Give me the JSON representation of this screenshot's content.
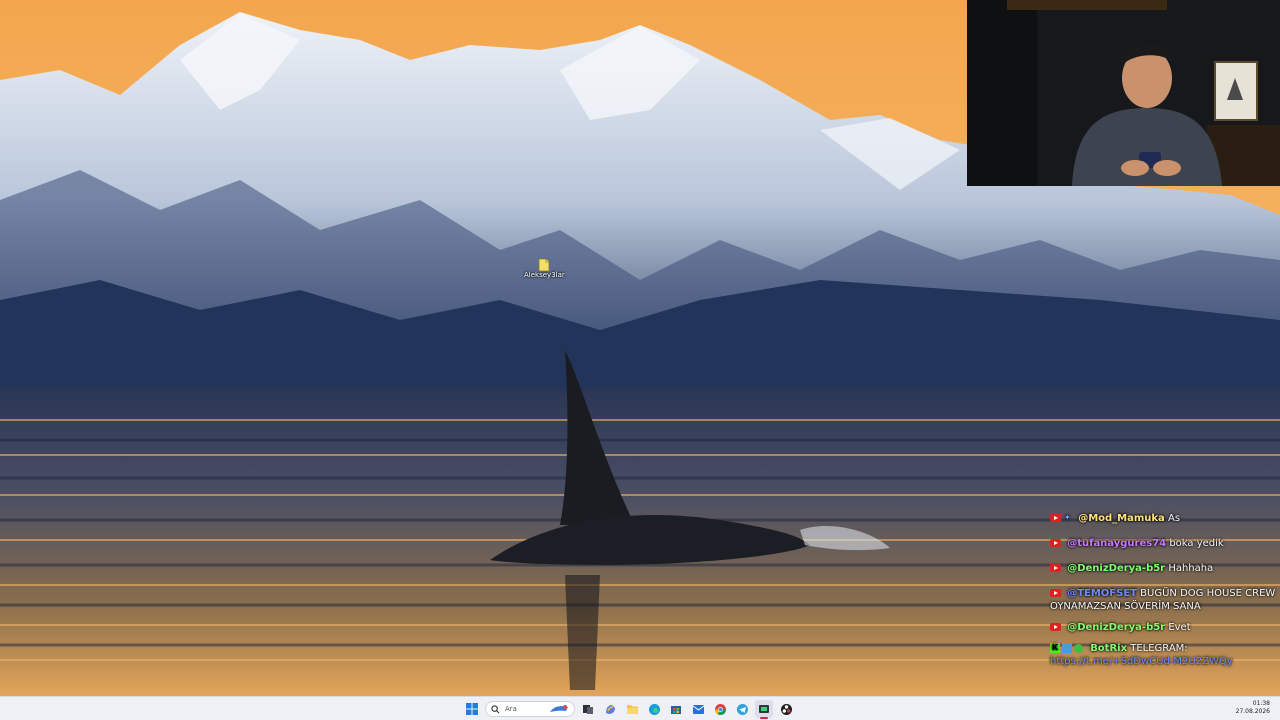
{
  "desktop": {
    "icons": [
      {
        "label": "Aleksey3lar",
        "icon": "file-icon"
      }
    ]
  },
  "chat": {
    "messages": [
      {
        "user": "@Mod_Mamuka",
        "text": "As",
        "user_color": "#ffe27a",
        "badges": [
          "youtube-badge",
          "moderator-badge"
        ]
      },
      {
        "user": "@tufanaygures74",
        "text": "boka yedik",
        "user_color": "#c678ff",
        "badges": [
          "youtube-badge"
        ]
      },
      {
        "user": "@DenizDerya-b5r",
        "text": "Hahhaha",
        "user_color": "#7cff6b",
        "badges": [
          "youtube-badge"
        ]
      },
      {
        "user": "@TEMOFSET",
        "text": "BUGÜN DOG HOUSE CREW OYNAMAZSAN SÖVERİM SANA",
        "user_color": "#6d8bff",
        "badges": [
          "youtube-badge"
        ]
      },
      {
        "user": "@DenizDerya-b5r",
        "text": "Evet",
        "user_color": "#7cff6b",
        "badges": [
          "youtube-badge"
        ]
      },
      {
        "user": "BotRix",
        "text": "TELEGRAM:",
        "user_color": "#7cff6b",
        "badges": [
          "kick-badge",
          "bot-badge",
          "verified-badge"
        ],
        "link": "https://t.me/+SdDwCUd-M2U2ZWQy"
      }
    ]
  },
  "taskbar": {
    "search_placeholder": "Ara",
    "clock_time": "01:38",
    "clock_date": "27.08.2026",
    "apps": [
      "start-icon",
      "search",
      "task-view-icon",
      "copilot-icon",
      "file-explorer-icon",
      "edge-icon",
      "store-icon",
      "mail-icon",
      "chrome-icon",
      "telegram-icon",
      "terminal-icon",
      "obs-icon"
    ],
    "active_app": "terminal-icon",
    "colors": {
      "bar": "#eef0f6",
      "accent": "#d0284a"
    }
  },
  "webcam": {
    "present": true
  }
}
